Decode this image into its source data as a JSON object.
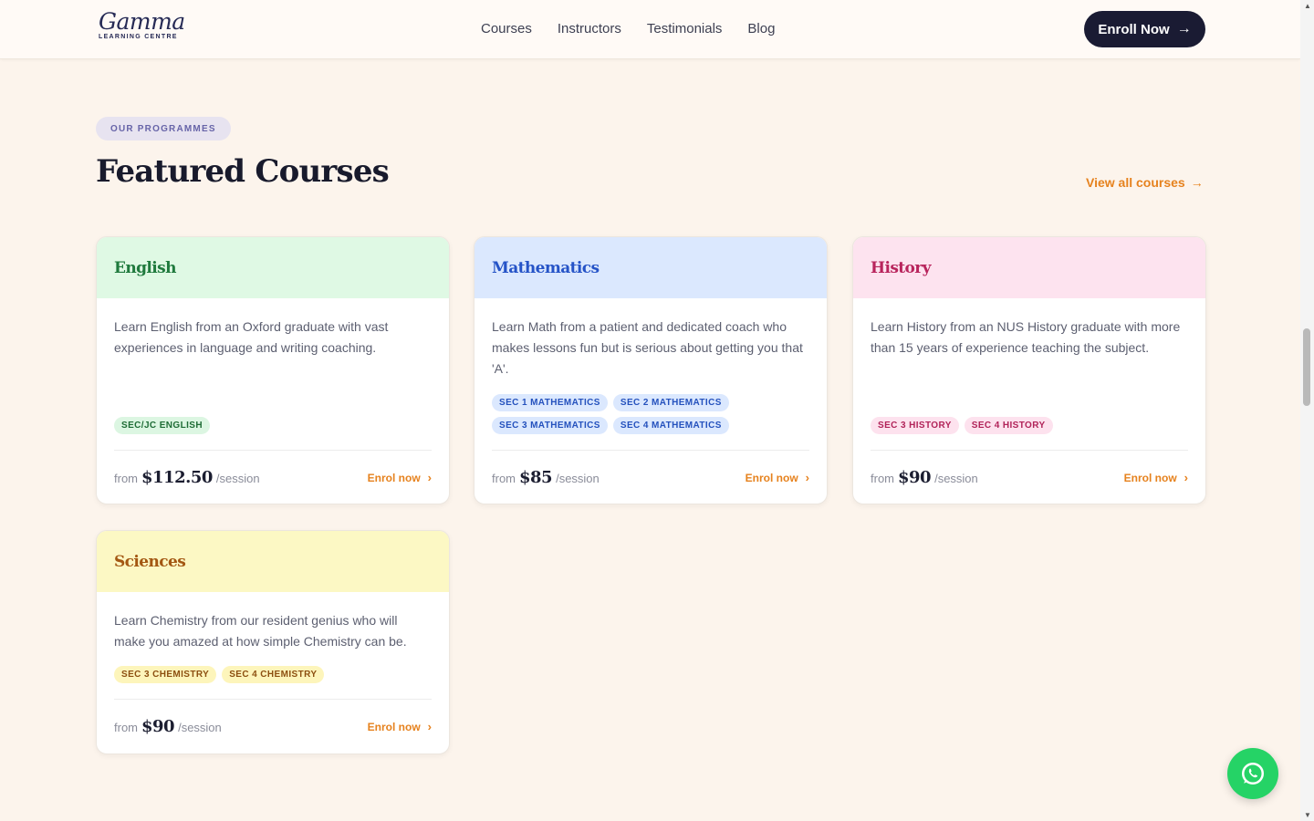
{
  "header": {
    "logo_script": "Gamma",
    "logo_sub": "LEARNING CENTRE",
    "nav": [
      "Courses",
      "Instructors",
      "Testimonials",
      "Blog"
    ],
    "cta_label": "Enroll Now"
  },
  "section": {
    "eyebrow": "OUR PROGRAMMES",
    "title": "Featured Courses",
    "view_all": "View all courses"
  },
  "courses": [
    {
      "title": "English",
      "description": "Learn English from an Oxford graduate with vast experiences in language and writing coaching.",
      "tags": [
        "SEC/JC ENGLISH"
      ],
      "from": "from",
      "price": "$112.50",
      "per": "/session",
      "cta": "Enrol now",
      "color": "#1f7a3d"
    },
    {
      "title": "Mathematics",
      "description": "Learn Math from a patient and dedicated coach who makes lessons fun but is serious about getting you that 'A'.",
      "tags": [
        "SEC 1 MATHEMATICS",
        "SEC 2 MATHEMATICS",
        "SEC 3 MATHEMATICS",
        "SEC 4 MATHEMATICS"
      ],
      "from": "from",
      "price": "$85",
      "per": "/session",
      "cta": "Enrol now",
      "color": "#2553c7"
    },
    {
      "title": "History",
      "description": "Learn History from an NUS History graduate with more than 15 years of experience teaching the subject.",
      "tags": [
        "SEC 3 HISTORY",
        "SEC 4 HISTORY"
      ],
      "from": "from",
      "price": "$90",
      "per": "/session",
      "cta": "Enrol now",
      "color": "#b8245c"
    },
    {
      "title": "Sciences",
      "description": "Learn Chemistry from our resident genius who will make you amazed at how simple Chemistry can be.",
      "tags": [
        "SEC 3 CHEMISTRY",
        "SEC 4 CHEMISTRY"
      ],
      "from": "from",
      "price": "$90",
      "per": "/session",
      "cta": "Enrol now",
      "color": "#a35712"
    }
  ],
  "floating": {
    "icon": "whatsapp-icon",
    "color": "#25d366"
  }
}
